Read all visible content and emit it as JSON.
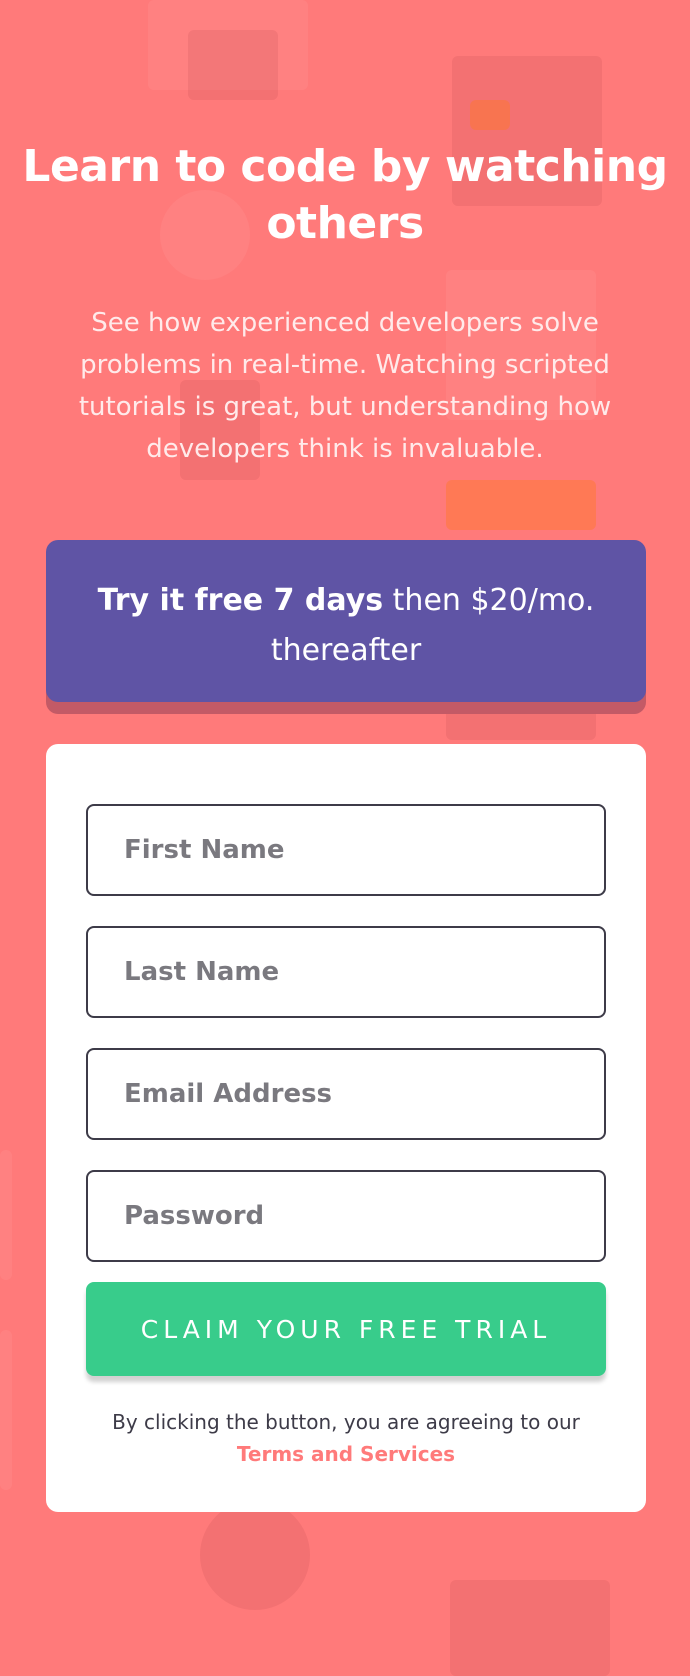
{
  "hero": {
    "title": "Learn to code by watching others",
    "description": "See how experienced developers solve problems in real-time. Watching scripted tutorials is great, but understanding how developers think is invaluable."
  },
  "offer": {
    "bold_text": "Try it free 7 days",
    "rest_text": " then $20/mo. thereafter"
  },
  "form": {
    "first_name_placeholder": "First Name",
    "last_name_placeholder": "Last Name",
    "email_placeholder": "Email Address",
    "password_placeholder": "Password",
    "submit_label": "Claim your free trial",
    "terms_text": "By clicking the button, you are agreeing to our",
    "terms_link": "Terms and Services"
  },
  "colors": {
    "background": "#ff7a7a",
    "offer": "#5f54a5",
    "cta": "#38cc8b",
    "text_dark": "#3d3b48"
  }
}
